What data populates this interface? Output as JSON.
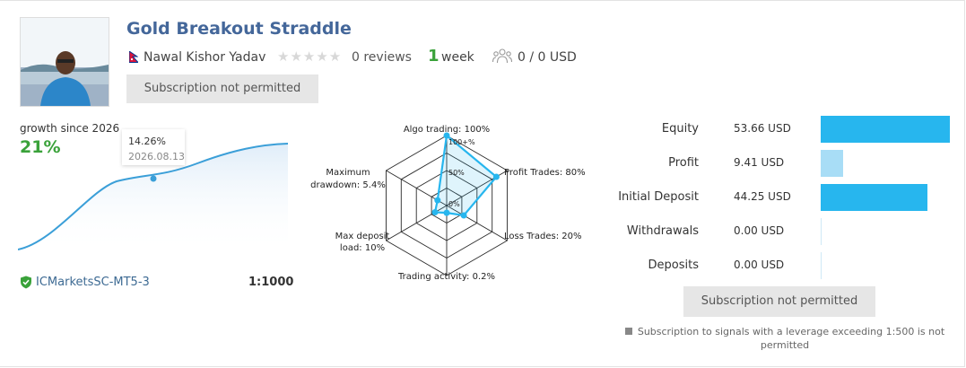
{
  "signal": {
    "title": "Gold Breakout Straddle",
    "author": "Nawal Kishor Yadav",
    "stars": "★★★★★",
    "reviews": "0 reviews",
    "weeks_num": "1",
    "weeks_label": "week",
    "subscribers": "0 / 0 USD",
    "subscribe_top": "Subscription not permitted",
    "subscribe_bottom": "Subscription not permitted"
  },
  "growth": {
    "label": "growth since 2026",
    "value": "21%",
    "tooltip_value": "14.26%",
    "tooltip_date": "2026.08.13",
    "curve_points": [
      [
        0,
        0
      ],
      [
        0.25,
        3
      ],
      [
        0.5,
        10
      ],
      [
        0.75,
        14.26
      ],
      [
        1,
        21
      ]
    ]
  },
  "account": {
    "broker": "ICMarketsSC-MT5-3",
    "leverage": "1:1000"
  },
  "radar": {
    "labels": {
      "algo": "Algo trading: 100%",
      "profit_trades": "Profit Trades: 80%",
      "loss_trades": "Loss Trades: 20%",
      "activity": "Trading activity: 0.2%",
      "deposit_load_1": "Max deposit",
      "deposit_load_2": "load: 10%",
      "drawdown_1": "Maximum",
      "drawdown_2": "drawdown: 5.4%"
    },
    "scale_top": "100+%",
    "scale_mid": "50%",
    "scale_zero": "0%",
    "values": [
      100,
      80,
      20,
      0.2,
      10,
      5.4
    ]
  },
  "stats": [
    {
      "label": "Equity",
      "value": "53.66 USD",
      "amount": 53.66
    },
    {
      "label": "Profit",
      "value": "9.41 USD",
      "amount": 9.41
    },
    {
      "label": "Initial Deposit",
      "value": "44.25 USD",
      "amount": 44.25
    },
    {
      "label": "Withdrawals",
      "value": "0.00 USD",
      "amount": 0
    },
    {
      "label": "Deposits",
      "value": "0.00 USD",
      "amount": 0
    }
  ],
  "colors": {
    "bar": "#27b6ee",
    "bar_light": "#a8ddf6",
    "green": "#3aa23a",
    "line": "#3b9fd8"
  },
  "note": "Subscription to signals with a leverage exceeding 1:500 is not permitted"
}
